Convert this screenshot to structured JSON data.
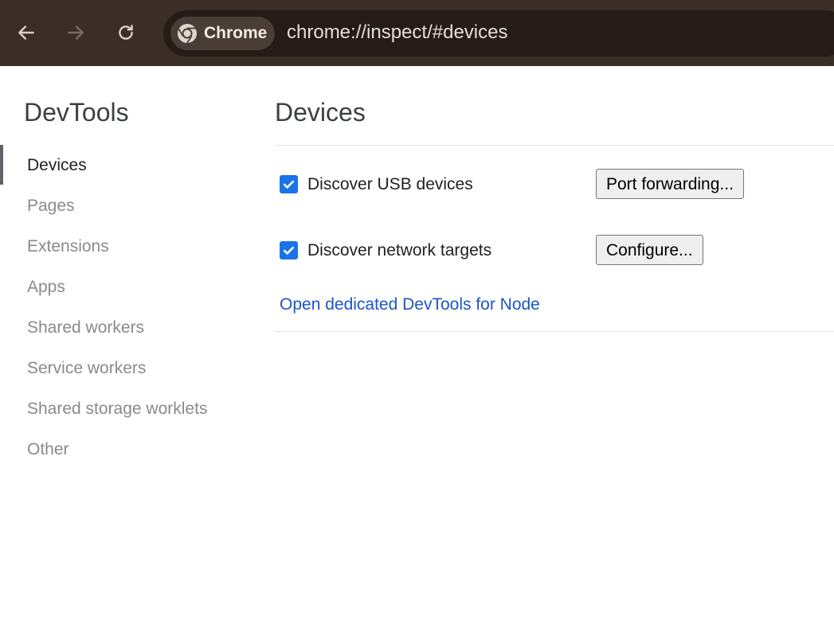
{
  "toolbar": {
    "back_icon": "arrow-left-icon",
    "forward_icon": "arrow-right-icon",
    "reload_icon": "reload-icon",
    "chip_label": "Chrome",
    "url": "chrome://inspect/#devices"
  },
  "sidebar": {
    "title": "DevTools",
    "items": [
      {
        "label": "Devices"
      },
      {
        "label": "Pages"
      },
      {
        "label": "Extensions"
      },
      {
        "label": "Apps"
      },
      {
        "label": "Shared workers"
      },
      {
        "label": "Service workers"
      },
      {
        "label": "Shared storage worklets"
      },
      {
        "label": "Other"
      }
    ],
    "selected": "Devices"
  },
  "main": {
    "title": "Devices",
    "usb": {
      "label": "Discover USB devices",
      "checked": true,
      "button": "Port forwarding..."
    },
    "network": {
      "label": "Discover network targets",
      "checked": true,
      "button": "Configure..."
    },
    "node_link": "Open dedicated DevTools for Node"
  },
  "colors": {
    "toolbar_bg": "#3b2e27",
    "omnibox_bg": "#261c17",
    "checkbox": "#1a73e8",
    "link": "#1a55c9"
  }
}
